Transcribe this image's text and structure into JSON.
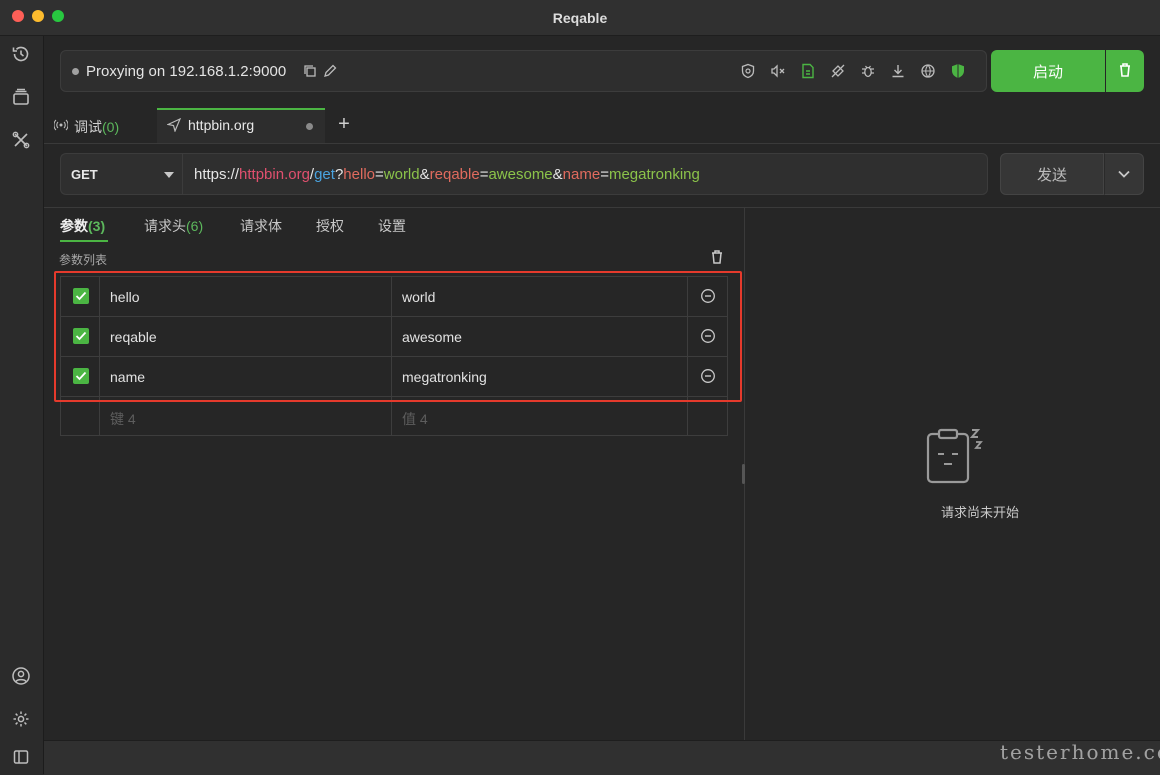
{
  "window": {
    "title": "Reqable"
  },
  "proxy": {
    "status_text": "Proxying on 192.168.1.2:9000",
    "start_label": "启动"
  },
  "tabs": [
    {
      "label": "调试",
      "count": "(0)"
    },
    {
      "label": "httpbin.org"
    }
  ],
  "request": {
    "method": "GET",
    "url": {
      "scheme": "https://",
      "host": "httpbin.org",
      "slash": "/",
      "path": "get",
      "q": "?",
      "params": [
        {
          "key": "hello",
          "eq": "=",
          "value": "world",
          "sep": "&"
        },
        {
          "key": "reqable",
          "eq": "=",
          "value": "awesome",
          "sep": "&"
        },
        {
          "key": "name",
          "eq": "=",
          "value": "megatronking",
          "sep": ""
        }
      ]
    },
    "send_label": "发送"
  },
  "subtabs": {
    "params": {
      "label": "参数",
      "count": "(3)"
    },
    "headers": {
      "label": "请求头",
      "count": "(6)"
    },
    "body": {
      "label": "请求体"
    },
    "auth": {
      "label": "授权"
    },
    "settings": {
      "label": "设置"
    }
  },
  "params_list": {
    "title": "参数列表",
    "rows": [
      {
        "checked": true,
        "key": "hello",
        "value": "world"
      },
      {
        "checked": true,
        "key": "reqable",
        "value": "awesome"
      },
      {
        "checked": true,
        "key": "name",
        "value": "megatronking"
      }
    ],
    "placeholder": {
      "key": "键 4",
      "value": "值 4"
    }
  },
  "response": {
    "empty_text": "请求尚未开始"
  },
  "watermark": "testerhome.com",
  "colors": {
    "accent": "#4bb543",
    "highlight": "#e53a2c"
  }
}
